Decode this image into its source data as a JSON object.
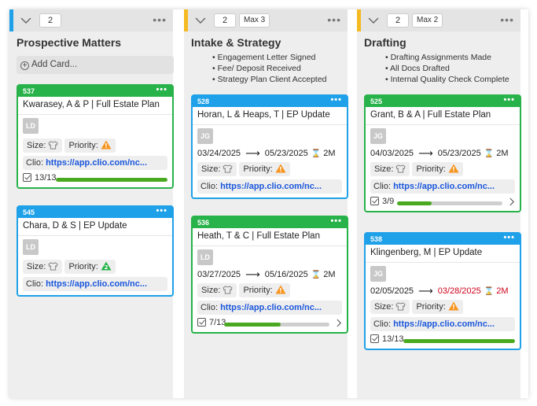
{
  "columns": [
    {
      "count": "2",
      "max": "",
      "stripe_color": "#1ea1e8",
      "title": "Prospective Matters",
      "add_card": "Add Card...",
      "bullets": [],
      "cards": [
        {
          "id": "537",
          "color": "green",
          "title": "Kwarasey, A & P | Full Estate Plan",
          "avatar": "LD",
          "dates": null,
          "size_label": "Size:",
          "priority_label": "Priority:",
          "priority_icon": "warning-orange",
          "priority_badge": "!",
          "clio_label": "Clio:",
          "clio_link": "https://app.clio.com/nc...",
          "progress": {
            "text": "13/13",
            "fraction": 1.0,
            "chevron": false
          }
        },
        {
          "id": "545",
          "color": "blue",
          "title": "Chara, D & S | EP Update",
          "avatar": "LD",
          "dates": null,
          "size_label": "Size:",
          "priority_label": "Priority:",
          "priority_icon": "priority-green",
          "priority_badge": "2",
          "clio_label": "Clio:",
          "clio_link": "https://app.clio.com/nc...",
          "progress": null
        }
      ]
    },
    {
      "count": "2",
      "max": "Max 3",
      "stripe_color": "#f5b921",
      "title": "Intake & Strategy",
      "add_card": "",
      "bullets": [
        "Engagement Letter Signed",
        "Fee/ Deposit Received",
        "Strategy Plan Client Accepted"
      ],
      "cards": [
        {
          "id": "528",
          "color": "blue",
          "title": "Horan, L & Heaps, T | EP Update",
          "avatar": "JG",
          "dates": {
            "start": "03/24/2025",
            "end": "05/23/2025",
            "duration": "2M",
            "late": false
          },
          "size_label": "Size:",
          "priority_label": "Priority:",
          "priority_icon": "warning-orange",
          "priority_badge": "!",
          "clio_label": "Clio:",
          "clio_link": "https://app.clio.com/nc...",
          "progress": null
        },
        {
          "id": "536",
          "color": "green",
          "title": "Heath, T & C | Full Estate Plan",
          "avatar": "LD",
          "dates": {
            "start": "03/27/2025",
            "end": "05/16/2025",
            "duration": "2M",
            "late": false
          },
          "size_label": "Size:",
          "priority_label": "Priority:",
          "priority_icon": "warning-orange",
          "priority_badge": "!",
          "clio_label": "Clio:",
          "clio_link": "https://app.clio.com/nc...",
          "progress": {
            "text": "7/13",
            "fraction": 0.54,
            "chevron": true
          }
        }
      ]
    },
    {
      "count": "2",
      "max": "Max 2",
      "stripe_color": "#f5b921",
      "title": "Drafting",
      "add_card": "",
      "bullets": [
        "Drafting Assignments Made",
        "All Docs Drafted",
        "Internal Quality Check Complete"
      ],
      "cards": [
        {
          "id": "525",
          "color": "green",
          "title": "Grant, B & A | Full Estate Plan",
          "avatar": "JG",
          "dates": {
            "start": "04/03/2025",
            "end": "05/23/2025",
            "duration": "2M",
            "late": false
          },
          "size_label": "Size:",
          "priority_label": "Priority:",
          "priority_icon": "warning-orange",
          "priority_badge": "!",
          "clio_label": "Clio:",
          "clio_link": "https://app.clio.com/nc...",
          "progress": {
            "text": "3/9",
            "fraction": 0.33,
            "chevron": true
          }
        },
        {
          "id": "538",
          "color": "blue",
          "title": "Klingenberg, M | EP Update",
          "avatar": "JG",
          "dates": {
            "start": "02/05/2025",
            "end": "03/28/2025",
            "duration": "2M",
            "late": true
          },
          "size_label": "Size:",
          "priority_label": "Priority:",
          "priority_icon": "warning-orange",
          "priority_badge": "!",
          "clio_label": "Clio:",
          "clio_link": "https://app.clio.com/nc...",
          "progress": {
            "text": "13/13",
            "fraction": 1.0,
            "chevron": false
          }
        }
      ]
    }
  ],
  "colors": {
    "green": "#27b24a",
    "blue": "#1ea1e8",
    "yellow": "#f5b921",
    "link": "#1a56db",
    "late": "#d0021b",
    "warning": "#f7941d",
    "progress": "#4aaa1f"
  }
}
